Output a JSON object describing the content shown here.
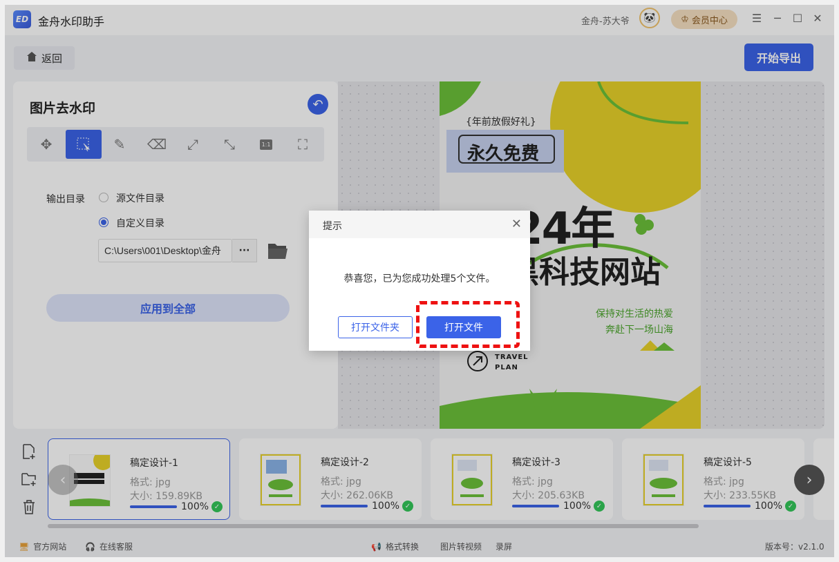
{
  "app": {
    "title": "金舟水印助手",
    "logo_text": "ED",
    "user_name": "金舟-苏大爷",
    "vip_label": "会员中心"
  },
  "toolbar": {
    "back_label": "返回",
    "export_label": "开始导出"
  },
  "panel": {
    "title": "图片去水印",
    "output_label": "输出目录",
    "option_source": "源文件目录",
    "option_custom": "自定义目录",
    "selected_option": "自定义目录",
    "path_value": "C:\\Users\\001\\Desktop\\金舟",
    "more_label": "···",
    "apply_label": "应用到全部",
    "tools": [
      "move-icon",
      "select-icon",
      "brush-icon",
      "eraser-icon",
      "expand-icon",
      "shrink-icon",
      "ratio-icon",
      "fit-icon"
    ],
    "active_tool": "select-icon",
    "ratio_text": "1:1"
  },
  "poster": {
    "tag": "{年前放假好礼}",
    "badge": "永久免费",
    "year": "2024年",
    "headline": "黑科技网站",
    "slogan1": "保持对生活的热爱",
    "slogan2": "奔赴下一场山海",
    "travel1": "TRAVEL",
    "travel2": "PLAN"
  },
  "files": [
    {
      "name": "稿定设计-1",
      "format": "格式: jpg",
      "size": "大小: 159.89KB",
      "progress": "100%",
      "selected": true
    },
    {
      "name": "稿定设计-2",
      "format": "格式: jpg",
      "size": "大小: 262.06KB",
      "progress": "100%",
      "selected": false
    },
    {
      "name": "稿定设计-3",
      "format": "格式: jpg",
      "size": "大小: 205.63KB",
      "progress": "100%",
      "selected": false
    },
    {
      "name": "稿定设计-5",
      "format": "格式: jpg",
      "size": "大小: 233.55KB",
      "progress": "100%",
      "selected": false
    }
  ],
  "statusbar": {
    "website": "官方网站",
    "support": "在线客服",
    "format_convert": "格式转换",
    "img_to_video": "图片转视频",
    "record": "录屏",
    "version": "版本号：v2.1.0"
  },
  "dialog": {
    "title": "提示",
    "message": "恭喜您，已为您成功处理5个文件。",
    "open_folder": "打开文件夹",
    "open_file": "打开文件"
  },
  "colors": {
    "accent": "#3b63e8",
    "success": "#34c759",
    "poster_yellow": "#e8d22a",
    "poster_green": "#6cc13a",
    "highlight_red": "#ee1111"
  }
}
